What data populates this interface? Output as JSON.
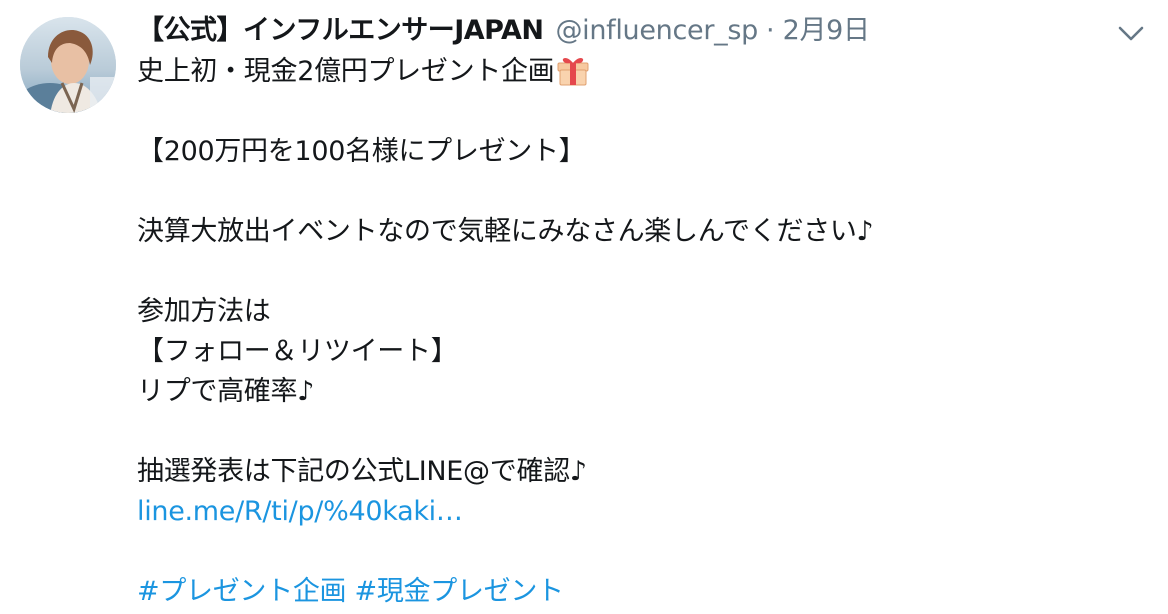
{
  "tweet": {
    "display_name": "【公式】インフルエンサーJAPAN",
    "handle": "@influencer_sp",
    "separator": "·",
    "date": "2月9日",
    "avatar_icon": "profile-photo",
    "caret_icon": "chevron-down-icon",
    "body": {
      "line1": "史上初・現金2億円プレゼント企画",
      "gift_emoji": "gift-icon",
      "line2": "【200万円を100名様にプレゼント】",
      "line3": "決算大放出イベントなので気軽にみなさん楽しんでください♪",
      "line4": "参加方法は",
      "line5": "【フォロー＆リツイート】",
      "line6": "リプで高確率♪",
      "line7": "抽選発表は下記の公式LINE@で確認♪",
      "link": "line.me/R/ti/p/%40kaki…",
      "hashtags": [
        "#プレゼント企画",
        "#現金プレゼント"
      ]
    }
  },
  "colors": {
    "text": "#14171a",
    "secondary": "#657786",
    "link": "#1b95e0"
  }
}
